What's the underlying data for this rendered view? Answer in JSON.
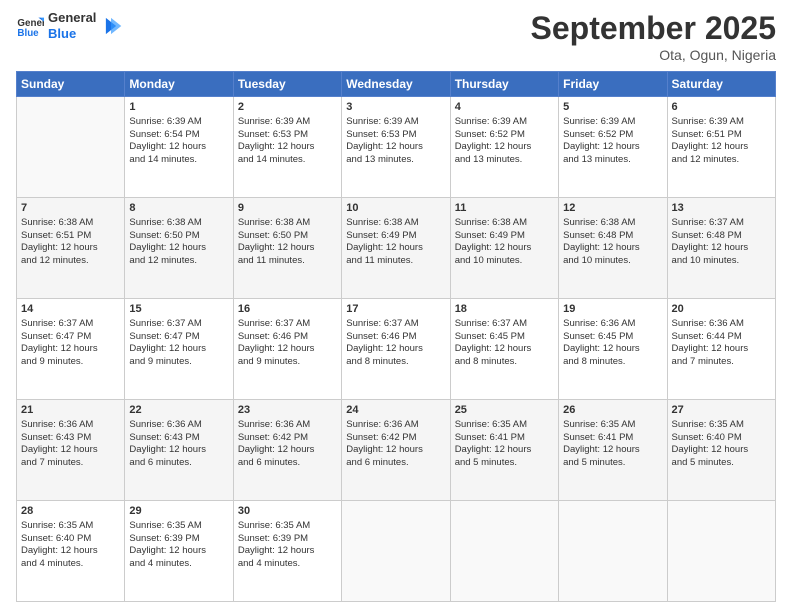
{
  "logo": {
    "line1": "General",
    "line2": "Blue"
  },
  "title": "September 2025",
  "location": "Ota, Ogun, Nigeria",
  "days_of_week": [
    "Sunday",
    "Monday",
    "Tuesday",
    "Wednesday",
    "Thursday",
    "Friday",
    "Saturday"
  ],
  "weeks": [
    [
      {
        "day": "",
        "info": ""
      },
      {
        "day": "1",
        "info": "Sunrise: 6:39 AM\nSunset: 6:54 PM\nDaylight: 12 hours\nand 14 minutes."
      },
      {
        "day": "2",
        "info": "Sunrise: 6:39 AM\nSunset: 6:53 PM\nDaylight: 12 hours\nand 14 minutes."
      },
      {
        "day": "3",
        "info": "Sunrise: 6:39 AM\nSunset: 6:53 PM\nDaylight: 12 hours\nand 13 minutes."
      },
      {
        "day": "4",
        "info": "Sunrise: 6:39 AM\nSunset: 6:52 PM\nDaylight: 12 hours\nand 13 minutes."
      },
      {
        "day": "5",
        "info": "Sunrise: 6:39 AM\nSunset: 6:52 PM\nDaylight: 12 hours\nand 13 minutes."
      },
      {
        "day": "6",
        "info": "Sunrise: 6:39 AM\nSunset: 6:51 PM\nDaylight: 12 hours\nand 12 minutes."
      }
    ],
    [
      {
        "day": "7",
        "info": "Sunrise: 6:38 AM\nSunset: 6:51 PM\nDaylight: 12 hours\nand 12 minutes."
      },
      {
        "day": "8",
        "info": "Sunrise: 6:38 AM\nSunset: 6:50 PM\nDaylight: 12 hours\nand 12 minutes."
      },
      {
        "day": "9",
        "info": "Sunrise: 6:38 AM\nSunset: 6:50 PM\nDaylight: 12 hours\nand 11 minutes."
      },
      {
        "day": "10",
        "info": "Sunrise: 6:38 AM\nSunset: 6:49 PM\nDaylight: 12 hours\nand 11 minutes."
      },
      {
        "day": "11",
        "info": "Sunrise: 6:38 AM\nSunset: 6:49 PM\nDaylight: 12 hours\nand 10 minutes."
      },
      {
        "day": "12",
        "info": "Sunrise: 6:38 AM\nSunset: 6:48 PM\nDaylight: 12 hours\nand 10 minutes."
      },
      {
        "day": "13",
        "info": "Sunrise: 6:37 AM\nSunset: 6:48 PM\nDaylight: 12 hours\nand 10 minutes."
      }
    ],
    [
      {
        "day": "14",
        "info": "Sunrise: 6:37 AM\nSunset: 6:47 PM\nDaylight: 12 hours\nand 9 minutes."
      },
      {
        "day": "15",
        "info": "Sunrise: 6:37 AM\nSunset: 6:47 PM\nDaylight: 12 hours\nand 9 minutes."
      },
      {
        "day": "16",
        "info": "Sunrise: 6:37 AM\nSunset: 6:46 PM\nDaylight: 12 hours\nand 9 minutes."
      },
      {
        "day": "17",
        "info": "Sunrise: 6:37 AM\nSunset: 6:46 PM\nDaylight: 12 hours\nand 8 minutes."
      },
      {
        "day": "18",
        "info": "Sunrise: 6:37 AM\nSunset: 6:45 PM\nDaylight: 12 hours\nand 8 minutes."
      },
      {
        "day": "19",
        "info": "Sunrise: 6:36 AM\nSunset: 6:45 PM\nDaylight: 12 hours\nand 8 minutes."
      },
      {
        "day": "20",
        "info": "Sunrise: 6:36 AM\nSunset: 6:44 PM\nDaylight: 12 hours\nand 7 minutes."
      }
    ],
    [
      {
        "day": "21",
        "info": "Sunrise: 6:36 AM\nSunset: 6:43 PM\nDaylight: 12 hours\nand 7 minutes."
      },
      {
        "day": "22",
        "info": "Sunrise: 6:36 AM\nSunset: 6:43 PM\nDaylight: 12 hours\nand 6 minutes."
      },
      {
        "day": "23",
        "info": "Sunrise: 6:36 AM\nSunset: 6:42 PM\nDaylight: 12 hours\nand 6 minutes."
      },
      {
        "day": "24",
        "info": "Sunrise: 6:36 AM\nSunset: 6:42 PM\nDaylight: 12 hours\nand 6 minutes."
      },
      {
        "day": "25",
        "info": "Sunrise: 6:35 AM\nSunset: 6:41 PM\nDaylight: 12 hours\nand 5 minutes."
      },
      {
        "day": "26",
        "info": "Sunrise: 6:35 AM\nSunset: 6:41 PM\nDaylight: 12 hours\nand 5 minutes."
      },
      {
        "day": "27",
        "info": "Sunrise: 6:35 AM\nSunset: 6:40 PM\nDaylight: 12 hours\nand 5 minutes."
      }
    ],
    [
      {
        "day": "28",
        "info": "Sunrise: 6:35 AM\nSunset: 6:40 PM\nDaylight: 12 hours\nand 4 minutes."
      },
      {
        "day": "29",
        "info": "Sunrise: 6:35 AM\nSunset: 6:39 PM\nDaylight: 12 hours\nand 4 minutes."
      },
      {
        "day": "30",
        "info": "Sunrise: 6:35 AM\nSunset: 6:39 PM\nDaylight: 12 hours\nand 4 minutes."
      },
      {
        "day": "",
        "info": ""
      },
      {
        "day": "",
        "info": ""
      },
      {
        "day": "",
        "info": ""
      },
      {
        "day": "",
        "info": ""
      }
    ]
  ]
}
